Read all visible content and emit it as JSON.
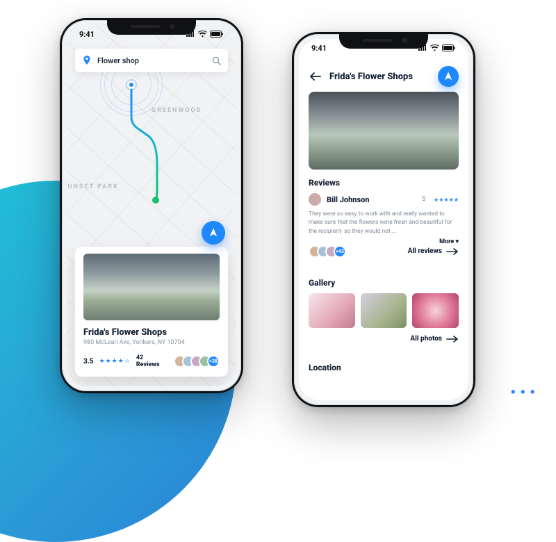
{
  "status": {
    "time": "9:41"
  },
  "left": {
    "search": {
      "value": "Flower shop"
    },
    "map": {
      "area1": "GREENWOOD",
      "area2": "SUNSET PARK"
    },
    "card": {
      "title": "Frida's Flower Shops",
      "address": "980 McLean Ave, Yonkers, NY 10704",
      "rating": "3.5",
      "stars": "★★★★☆",
      "reviews": "42 Reviews",
      "more": "+38"
    }
  },
  "right": {
    "title": "Frida's Flower Shops",
    "reviews": {
      "heading": "Reviews",
      "reviewer": "Bill Johnson",
      "rating": "5",
      "stars": "★★★★★",
      "text": "They were so easy to work with and really wanted to make sure that the flowers were fresh and beautiful for the recipient- so they would not …",
      "more_label": "More ▾",
      "foot_more": "+43",
      "all": "All reviews"
    },
    "gallery": {
      "heading": "Gallery",
      "all": "All photos"
    },
    "location": {
      "heading": "Location"
    }
  }
}
